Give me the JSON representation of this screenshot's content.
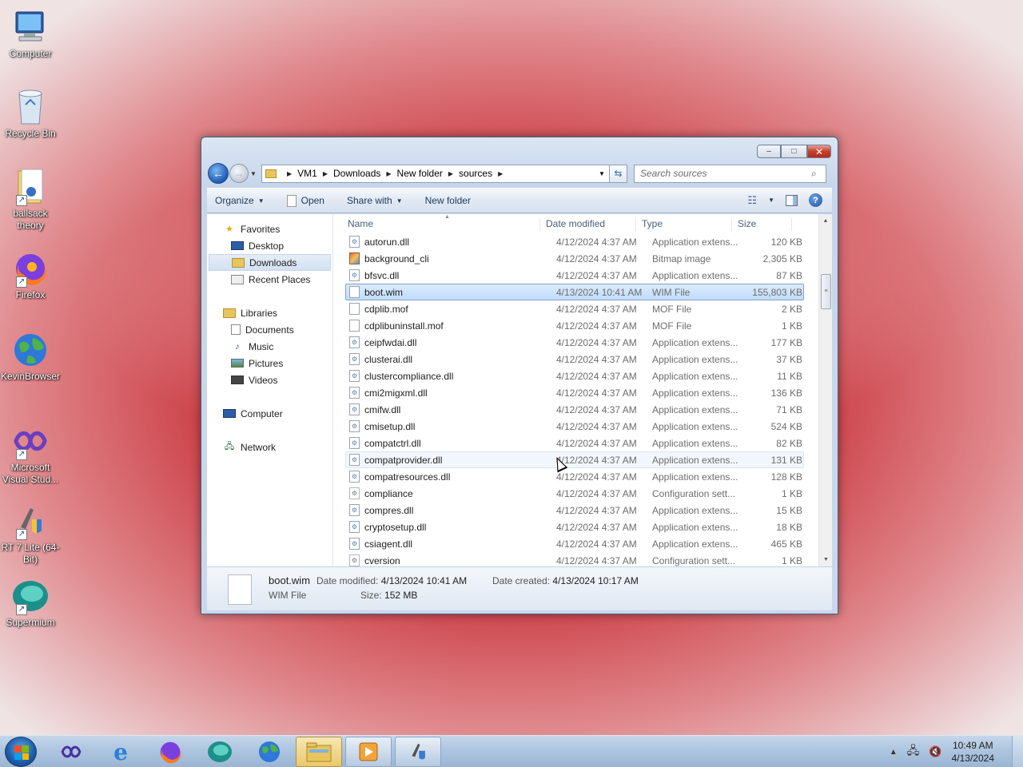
{
  "desktop": {
    "icons": [
      {
        "label": "Computer"
      },
      {
        "label": "Recycle Bin"
      },
      {
        "label": "ballsack theory"
      },
      {
        "label": "Firefox"
      },
      {
        "label": "KevinBrowser"
      },
      {
        "label": "Microsoft Visual Stud..."
      },
      {
        "label": "RT 7 Lite (64-Bit)"
      },
      {
        "label": "Supermium"
      }
    ]
  },
  "window": {
    "caption_buttons": {
      "minimize": "–",
      "maximize": "□",
      "close": "✕"
    },
    "address": {
      "crumbs": [
        "VM1",
        "Downloads",
        "New folder",
        "sources"
      ]
    },
    "search": {
      "placeholder": "Search sources"
    },
    "toolbar": {
      "organize": "Organize",
      "open": "Open",
      "share_with": "Share with",
      "new_folder": "New folder"
    },
    "nav": {
      "favorites": "Favorites",
      "desktop": "Desktop",
      "downloads": "Downloads",
      "recent_places": "Recent Places",
      "libraries": "Libraries",
      "documents": "Documents",
      "music": "Music",
      "pictures": "Pictures",
      "videos": "Videos",
      "computer": "Computer",
      "network": "Network"
    },
    "columns": {
      "name": "Name",
      "date": "Date modified",
      "type": "Type",
      "size": "Size"
    },
    "files": [
      {
        "name": "autorun.dll",
        "date": "4/12/2024 4:37 AM",
        "type": "Application extens...",
        "size": "120 KB",
        "icon": "dll"
      },
      {
        "name": "background_cli",
        "date": "4/12/2024 4:37 AM",
        "type": "Bitmap image",
        "size": "2,305 KB",
        "icon": "bmp"
      },
      {
        "name": "bfsvc.dll",
        "date": "4/12/2024 4:37 AM",
        "type": "Application extens...",
        "size": "87 KB",
        "icon": "dll"
      },
      {
        "name": "boot.wim",
        "date": "4/13/2024 10:41 AM",
        "type": "WIM File",
        "size": "155,803 KB",
        "icon": "blank"
      },
      {
        "name": "cdplib.mof",
        "date": "4/12/2024 4:37 AM",
        "type": "MOF File",
        "size": "2 KB",
        "icon": "blank"
      },
      {
        "name": "cdplibuninstall.mof",
        "date": "4/12/2024 4:37 AM",
        "type": "MOF File",
        "size": "1 KB",
        "icon": "blank"
      },
      {
        "name": "ceipfwdai.dll",
        "date": "4/12/2024 4:37 AM",
        "type": "Application extens...",
        "size": "177 KB",
        "icon": "dll"
      },
      {
        "name": "clusterai.dll",
        "date": "4/12/2024 4:37 AM",
        "type": "Application extens...",
        "size": "37 KB",
        "icon": "dll"
      },
      {
        "name": "clustercompliance.dll",
        "date": "4/12/2024 4:37 AM",
        "type": "Application extens...",
        "size": "11 KB",
        "icon": "dll"
      },
      {
        "name": "cmi2migxml.dll",
        "date": "4/12/2024 4:37 AM",
        "type": "Application extens...",
        "size": "136 KB",
        "icon": "dll"
      },
      {
        "name": "cmifw.dll",
        "date": "4/12/2024 4:37 AM",
        "type": "Application extens...",
        "size": "71 KB",
        "icon": "dll"
      },
      {
        "name": "cmisetup.dll",
        "date": "4/12/2024 4:37 AM",
        "type": "Application extens...",
        "size": "524 KB",
        "icon": "dll"
      },
      {
        "name": "compatctrl.dll",
        "date": "4/12/2024 4:37 AM",
        "type": "Application extens...",
        "size": "82 KB",
        "icon": "dll"
      },
      {
        "name": "compatprovider.dll",
        "date": "4/12/2024 4:37 AM",
        "type": "Application extens...",
        "size": "131 KB",
        "icon": "dll"
      },
      {
        "name": "compatresources.dll",
        "date": "4/12/2024 4:37 AM",
        "type": "Application extens...",
        "size": "128 KB",
        "icon": "dll"
      },
      {
        "name": "compliance",
        "date": "4/12/2024 4:37 AM",
        "type": "Configuration sett...",
        "size": "1 KB",
        "icon": "gear"
      },
      {
        "name": "compres.dll",
        "date": "4/12/2024 4:37 AM",
        "type": "Application extens...",
        "size": "15 KB",
        "icon": "dll"
      },
      {
        "name": "cryptosetup.dll",
        "date": "4/12/2024 4:37 AM",
        "type": "Application extens...",
        "size": "18 KB",
        "icon": "dll"
      },
      {
        "name": "csiagent.dll",
        "date": "4/12/2024 4:37 AM",
        "type": "Application extens...",
        "size": "465 KB",
        "icon": "dll"
      },
      {
        "name": "cversion",
        "date": "4/12/2024 4:37 AM",
        "type": "Configuration sett...",
        "size": "1 KB",
        "icon": "gear"
      }
    ],
    "selected_file": "boot.wim",
    "details": {
      "name": "boot.wim",
      "type": "WIM File",
      "modified_label": "Date modified:",
      "modified_value": "4/13/2024 10:41 AM",
      "size_label": "Size:",
      "size_value": "152 MB",
      "created_label": "Date created:",
      "created_value": "4/13/2024 10:17 AM"
    }
  },
  "taskbar": {
    "time": "10:49 AM",
    "date": "4/13/2024"
  }
}
